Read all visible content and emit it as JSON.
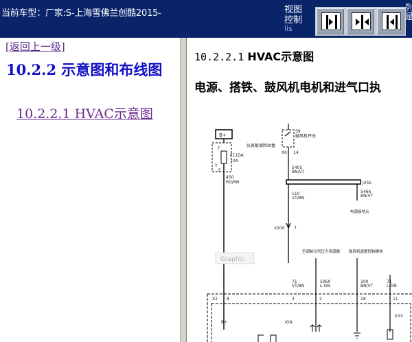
{
  "header": {
    "vehicle_label": "当前车型：厂家:S-上海雪佛兰创酷2015-",
    "view_control_label_1": "视图",
    "view_control_label_2": "控制",
    "view_control_extra": "lis",
    "clipped_text_1": "列",
    "clipped_text_2": "是"
  },
  "sidebar": {
    "back_link": "[返回上一级]",
    "section_title": "10.2.2 示意图和布线图",
    "sub_link": "10.2.2.1 HVAC示意图"
  },
  "content": {
    "heading_number": "10.2.2.1",
    "heading_title": "HVAC示意图",
    "subheading": "电源、搭铁、鼓风机电机和进气口执"
  },
  "diagram": {
    "labels": {
      "b_plus": "B+",
      "fuse_block_name": "仪表板保险丝盒",
      "fuse_f": "F",
      "fuse_id": "F11DA",
      "fuse_rating": "10A",
      "fuse_y": "Y",
      "fuse_ff": "F",
      "fuse_circuit": "450",
      "fuse_wire": "RD/BN",
      "relay_ref": "S9",
      "relay_name": "鼓风机开关",
      "relay_x": "X0",
      "relay_14": "14",
      "circuit_5405": "5405",
      "wire_bnvt": "BN/VT",
      "splice_j255": "J255",
      "circuit_110": "110",
      "wire_vtbn": "VT/BN",
      "circuit_5466": "5466",
      "wire_bnvt2": "BN/VT",
      "ground_name": "电源接地点",
      "x200": "X200",
      "pin_7": "7",
      "graphic_watermark": "Graphic",
      "sensor_left": "空调制冷剂压力传感器",
      "sensor_right": "鼓风机速度控制模块",
      "circuit_5060": "5060",
      "wire_lgn": "L-GN",
      "circuit_100": "100",
      "wire_bnvt3": "BN/VT",
      "circuit_71": "71",
      "wire_vtbn2": "VT/BN",
      "circuit_71b": "71",
      "wire_lgn2": "L-GN",
      "pin_x2": "X2",
      "pin_8": "8",
      "pin_3": "3",
      "pin_2": "2",
      "pin_18": "18",
      "pin_11": "11",
      "module_bplus": "B+",
      "module_ign": "IGN",
      "module_k33": "K33"
    }
  }
}
